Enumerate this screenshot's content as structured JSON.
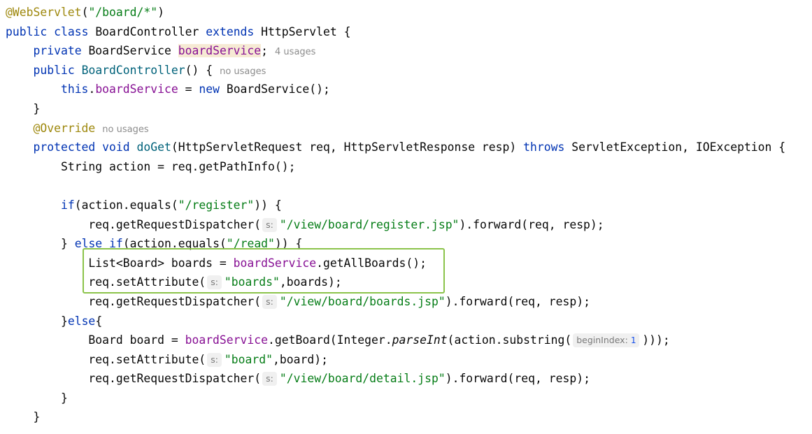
{
  "code": {
    "l1_annotation": "@WebServlet",
    "l1_paren_open": "(",
    "l1_string": "\"/board/*\"",
    "l1_paren_close": ")",
    "l2_public": "public",
    "l2_class": "class",
    "l2_name": "BoardController",
    "l2_extends": "extends",
    "l2_rest": "HttpServlet {",
    "l3_private": "private",
    "l3_type": "BoardService",
    "l3_field": "boardService",
    "l3_semicolon": ";",
    "l3_hint": "4 usages",
    "l4_public": "public",
    "l4_ctor": "BoardController",
    "l4_rest": "() {",
    "l4_hint": "no usages",
    "l5_this": "this",
    "l5_dot": ".",
    "l5_field": "boardService",
    "l5_eq": " = ",
    "l5_new": "new",
    "l5_rest": " BoardService();",
    "l6_brace": "}",
    "l7_annotation": "@Override",
    "l7_hint": "no usages",
    "l8_protected": "protected",
    "l8_void": "void",
    "l8_method": "doGet",
    "l8_params": "(HttpServletRequest req, HttpServletResponse resp) ",
    "l8_throws": "throws",
    "l8_rest": " ServletException, IOException {",
    "l9_text": "String action = req.getPathInfo();",
    "l11_if": "if",
    "l11_cond_start": "(action.equals(",
    "l11_string": "\"/register\"",
    "l11_cond_end": ")) {",
    "l12_call": "req.getRequestDispatcher(",
    "l12_hint": "s:",
    "l12_string": "\"/view/board/register.jsp\"",
    "l12_rest": ").forward(req, resp);",
    "l13_close": "} ",
    "l13_else": "else",
    "l13_sp": " ",
    "l13_if": "if",
    "l13_cond_start": "(action.equals(",
    "l13_string": "\"/read\"",
    "l13_cond_end": ")) {",
    "l14_decl": "List<Board> boards = ",
    "l14_field": "boardService",
    "l14_rest": ".getAllBoards();",
    "l15_call": "req.setAttribute(",
    "l15_hint": "s:",
    "l15_string": "\"boards\"",
    "l15_rest": ",boards);",
    "l16_call": "req.getRequestDispatcher(",
    "l16_hint": "s:",
    "l16_string": "\"/view/board/boards.jsp\"",
    "l16_rest": ").forward(req, resp);",
    "l17_close": "}",
    "l17_else": "else",
    "l17_brace": "{",
    "l18_decl": "Board board = ",
    "l18_field": "boardService",
    "l18_mid": ".getBoard(Integer.",
    "l18_parse": "parseInt",
    "l18_sub": "(action.substring(",
    "l18_hint_label": "beginIndex:",
    "l18_hint_value": "1",
    "l18_rest": ")));",
    "l19_call": "req.setAttribute(",
    "l19_hint": "s:",
    "l19_string": "\"board\"",
    "l19_rest": ",board);",
    "l20_call": "req.getRequestDispatcher(",
    "l20_hint": "s:",
    "l20_string": "\"/view/board/detail.jsp\"",
    "l20_rest": ").forward(req, resp);",
    "l21_brace": "}",
    "l22_brace": "}"
  },
  "colors": {
    "keyword": "#0033b3",
    "annotation": "#9e880d",
    "string": "#067d17",
    "field": "#871094",
    "method_decl": "#00627a",
    "highlight_box": "#8bc34a"
  }
}
